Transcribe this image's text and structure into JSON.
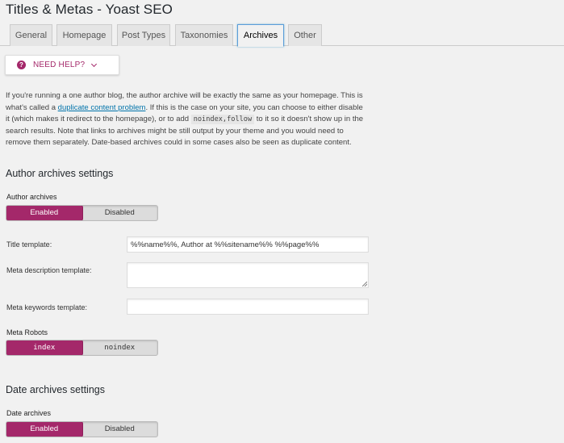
{
  "page": {
    "title": "Titles & Metas - Yoast SEO"
  },
  "tabs": [
    {
      "label": "General"
    },
    {
      "label": "Homepage"
    },
    {
      "label": "Post Types"
    },
    {
      "label": "Taxonomies"
    },
    {
      "label": "Archives",
      "active": true
    },
    {
      "label": "Other"
    }
  ],
  "help": {
    "label": "NEED HELP?",
    "icon": "question-icon"
  },
  "intro": {
    "part1": "If you're running a one author blog, the author archive will be exactly the same as your homepage. This is what's called a ",
    "link": "duplicate content problem",
    "part2": ". If this is the case on your site, you can choose to either disable it (which makes it redirect to the homepage), or to add ",
    "code": "noindex,follow",
    "part3": " to it so it doesn't show up in the search results. Note that links to archives might be still output by your theme and you would need to remove them separately. Date-based archives could in some cases also be seen as duplicate content."
  },
  "author_section": {
    "title": "Author archives settings",
    "archives_label": "Author archives",
    "archives_switch": {
      "on": "Enabled",
      "off": "Disabled",
      "selected": "Enabled"
    },
    "title_template_label": "Title template:",
    "title_template_value": "%%name%%, Author at %%sitename%% %%page%%",
    "meta_desc_label": "Meta description template:",
    "meta_desc_value": "",
    "meta_keywords_label": "Meta keywords template:",
    "meta_keywords_value": "",
    "robots_label": "Meta Robots",
    "robots_switch": {
      "on": "index",
      "off": "noindex",
      "selected": "index"
    }
  },
  "date_section": {
    "title": "Date archives settings",
    "archives_label": "Date archives",
    "archives_switch": {
      "on": "Enabled",
      "off": "Disabled",
      "selected": "Enabled"
    }
  },
  "colors": {
    "accent": "#a4286a",
    "link": "#0073aa",
    "background": "#f1f1f1"
  }
}
